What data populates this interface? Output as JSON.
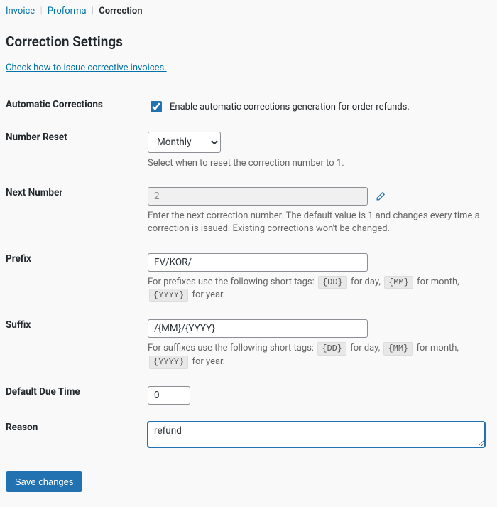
{
  "tabs": {
    "invoice": "Invoice",
    "proforma": "Proforma",
    "correction": "Correction"
  },
  "page_title": "Correction Settings",
  "help_link": "Check how to issue corrective invoices.",
  "fields": {
    "auto_corrections": {
      "label": "Automatic Corrections",
      "checkbox_label": "Enable automatic corrections generation for order refunds.",
      "checked": true
    },
    "number_reset": {
      "label": "Number Reset",
      "value": "Monthly",
      "desc": "Select when to reset the correction number to 1."
    },
    "next_number": {
      "label": "Next Number",
      "value": "2",
      "desc": "Enter the next correction number. The default value is 1 and changes every time a correction is issued. Existing corrections won't be changed."
    },
    "prefix": {
      "label": "Prefix",
      "value": "FV/KOR/",
      "desc_pre": "For prefixes use the following short tags: ",
      "tag_day": "{DD}",
      "t_day": " for day, ",
      "tag_month": "{MM}",
      "t_month": " for month, ",
      "tag_year": "{YYYY}",
      "t_year": " for year."
    },
    "suffix": {
      "label": "Suffix",
      "value": "/{MM}/{YYYY}",
      "desc_pre": "For suffixes use the following short tags: ",
      "tag_day": "{DD}",
      "t_day": " for day, ",
      "tag_month": "{MM}",
      "t_month": " for month, ",
      "tag_year": "{YYYY}",
      "t_year": " for year."
    },
    "due_time": {
      "label": "Default Due Time",
      "value": "0"
    },
    "reason": {
      "label": "Reason",
      "value": "refund"
    }
  },
  "save_label": "Save changes"
}
